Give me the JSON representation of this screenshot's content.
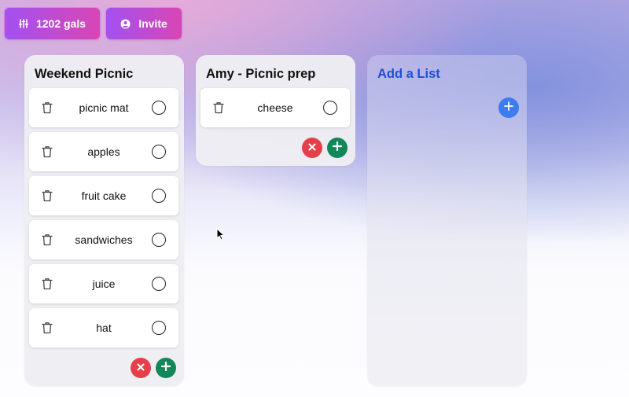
{
  "header": {
    "gals_label": "1202 gals",
    "invite_label": "Invite"
  },
  "lists": [
    {
      "title": "Weekend Picnic",
      "items": [
        "picnic mat",
        "apples",
        "fruit cake",
        "sandwiches",
        "juice",
        "hat"
      ]
    },
    {
      "title": "Amy - Picnic prep",
      "items": [
        "cheese"
      ]
    }
  ],
  "add_list": {
    "title": "Add a List"
  },
  "colors": {
    "button_gradient_start": "#a351f0",
    "button_gradient_end": "#d946b4",
    "cancel": "#e5404a",
    "add": "#12875a",
    "add_list_title": "#1d4ed8",
    "add_list_button": "#3b7cf0"
  },
  "icons": {
    "gals": "sliders-icon",
    "invite": "user-circle-icon",
    "delete": "trash-icon",
    "complete": "circle-icon",
    "cancel": "x-icon",
    "add": "plus-icon"
  }
}
